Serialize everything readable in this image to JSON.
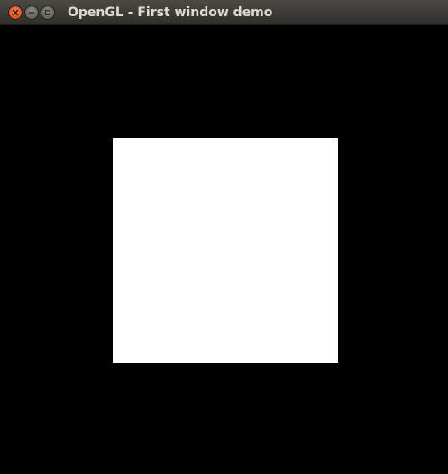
{
  "window": {
    "title": "OpenGL - First window demo"
  },
  "controls": {
    "close_icon": "close-icon",
    "minimize_icon": "minimize-icon",
    "maximize_icon": "maximize-icon"
  },
  "colors": {
    "background": "#000000",
    "quad": "#ffffff",
    "close_button": "#e65a2c",
    "titlebar": "#3c3b37",
    "title_text": "#dfdbd2"
  }
}
